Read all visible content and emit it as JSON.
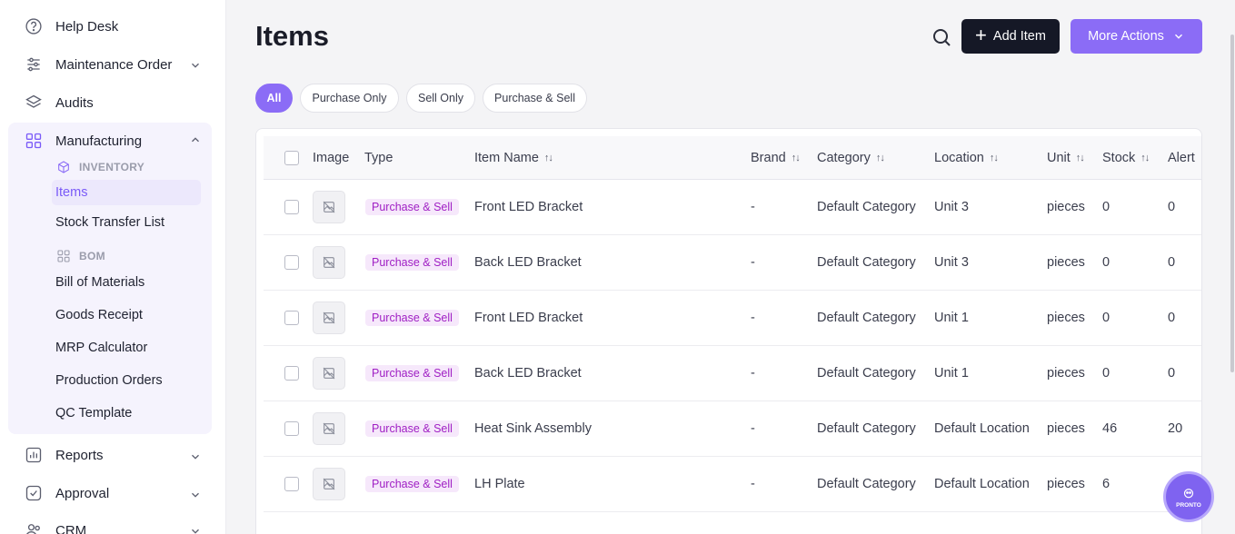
{
  "sidebar": {
    "help_desk": "Help Desk",
    "maintenance_order": "Maintenance Order",
    "audits": "Audits",
    "manufacturing": "Manufacturing",
    "inventory_head": "INVENTORY",
    "items": "Items",
    "stock_transfer": "Stock Transfer List",
    "bom_head": "BOM",
    "bill_of_materials": "Bill of Materials",
    "goods_receipt": "Goods Receipt",
    "mrp_calculator": "MRP Calculator",
    "production_orders": "Production Orders",
    "qc_template": "QC Template",
    "reports": "Reports",
    "approval": "Approval",
    "crm": "CRM"
  },
  "header": {
    "title": "Items",
    "add_label": "Add Item",
    "more_label": "More Actions"
  },
  "filters": [
    "All",
    "Purchase Only",
    "Sell Only",
    "Purchase & Sell"
  ],
  "table": {
    "columns": [
      "Image",
      "Type",
      "Item Name",
      "Brand",
      "Category",
      "Location",
      "Unit",
      "Stock",
      "Alert"
    ],
    "rows": [
      {
        "type": "Purchase & Sell",
        "name": "Front LED Bracket",
        "brand": "-",
        "category": "Default Category",
        "location": "Unit 3",
        "unit": "pieces",
        "stock": "0",
        "alert": "0"
      },
      {
        "type": "Purchase & Sell",
        "name": "Back LED Bracket",
        "brand": "-",
        "category": "Default Category",
        "location": "Unit 3",
        "unit": "pieces",
        "stock": "0",
        "alert": "0"
      },
      {
        "type": "Purchase & Sell",
        "name": "Front LED Bracket",
        "brand": "-",
        "category": "Default Category",
        "location": "Unit 1",
        "unit": "pieces",
        "stock": "0",
        "alert": "0"
      },
      {
        "type": "Purchase & Sell",
        "name": "Back LED Bracket",
        "brand": "-",
        "category": "Default Category",
        "location": "Unit 1",
        "unit": "pieces",
        "stock": "0",
        "alert": "0"
      },
      {
        "type": "Purchase & Sell",
        "name": "Heat Sink Assembly",
        "brand": "-",
        "category": "Default Category",
        "location": "Default Location",
        "unit": "pieces",
        "stock": "46",
        "alert": "20"
      },
      {
        "type": "Purchase & Sell",
        "name": "LH Plate",
        "brand": "-",
        "category": "Default Category",
        "location": "Default Location",
        "unit": "pieces",
        "stock": "6",
        "alert": ""
      }
    ]
  },
  "fab_label": "PRONTO",
  "colors": {
    "accent": "#8b6cf6",
    "dark_button": "#151826",
    "badge_text": "#a020c4",
    "badge_bg": "#f6e8fb"
  }
}
